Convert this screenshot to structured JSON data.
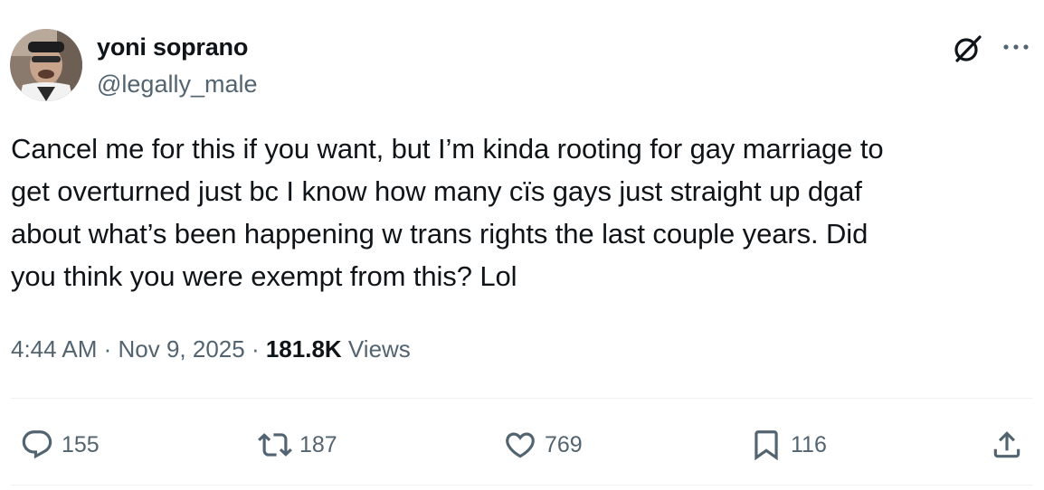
{
  "author": {
    "name": "yoni soprano",
    "handle": "@legally_male"
  },
  "tweet": {
    "text": "Cancel me for this if you want, but I’m kinda rooting for gay marriage to\nget overturned just bc I know how many cïs gays just straight up dgaf\nabout what’s been happening w trans rights the last couple years. Did\nyou think you were exempt from this? Lol"
  },
  "meta": {
    "time": "4:44 AM",
    "separator": " · ",
    "date": "Nov 9, 2025",
    "views_count": "181.8K",
    "views_label": "Views"
  },
  "actions": {
    "reply_count": "155",
    "retweet_count": "187",
    "like_count": "769",
    "bookmark_count": "116"
  },
  "icons": {
    "grok": "grok-icon",
    "more": "more-icon",
    "reply": "reply-icon",
    "retweet": "retweet-icon",
    "like": "heart-icon",
    "bookmark": "bookmark-icon",
    "share": "share-icon"
  },
  "colors": {
    "text_primary": "#0f1419",
    "text_secondary": "#536471",
    "divider": "#eff3f4"
  }
}
